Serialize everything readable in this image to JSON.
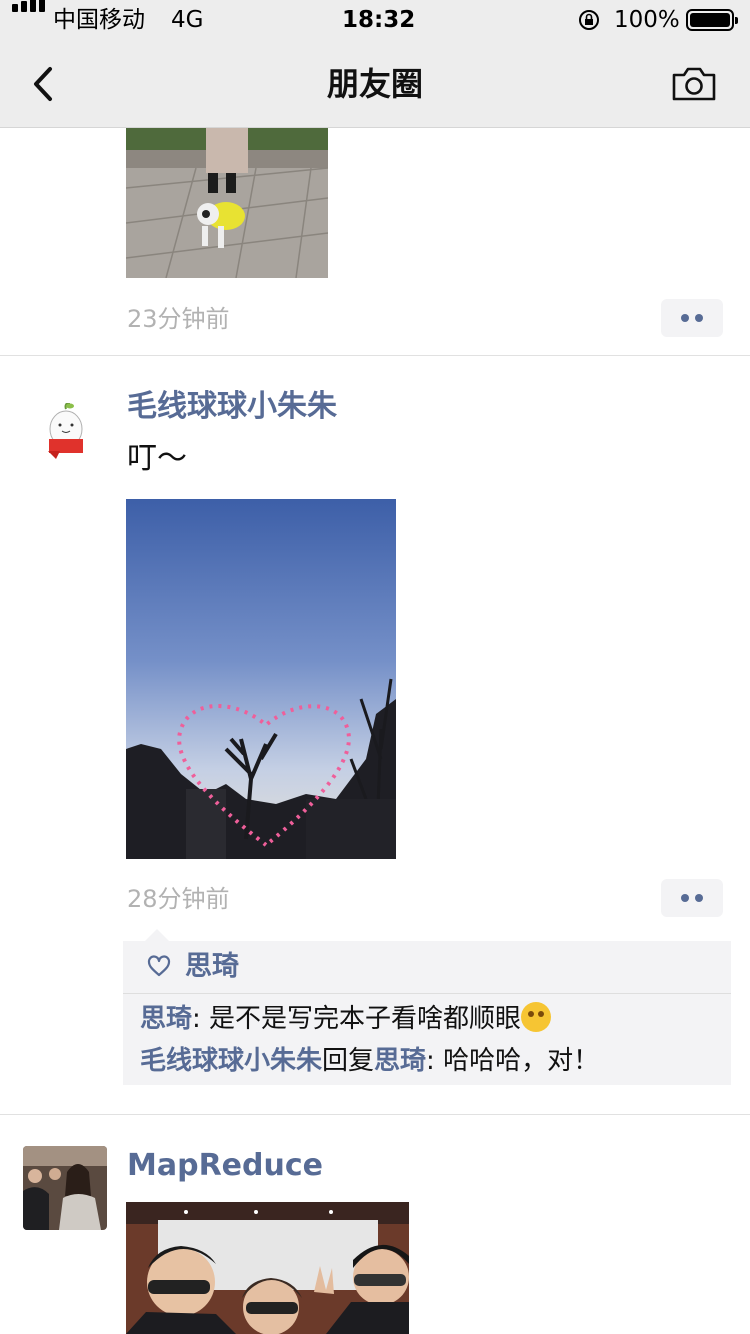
{
  "status": {
    "carrier": "中国移动",
    "network": "4G",
    "time": "18:32",
    "battery": "100%"
  },
  "nav": {
    "title": "朋友圈",
    "back_icon": "chevron-left-icon",
    "camera_icon": "camera-icon"
  },
  "colors": {
    "link": "#576b95",
    "bar": "#ededed",
    "muted": "#b2b2b2"
  },
  "posts": [
    {
      "time": "23分钟前"
    },
    {
      "author": "毛线球球小朱朱",
      "text": "叮～",
      "time": "28分钟前",
      "likes": {
        "icon": "heart-icon",
        "names": "思琦"
      },
      "comments": [
        {
          "author": "思琦",
          "sep": ": ",
          "text": "是不是写完本子看啥都顺眼"
        },
        {
          "author": "毛线球球小朱朱",
          "reply_word": "回复",
          "reply_to": "思琦",
          "sep": ": ",
          "text": "哈哈哈，对！"
        }
      ]
    },
    {
      "author": "MapReduce"
    }
  ]
}
